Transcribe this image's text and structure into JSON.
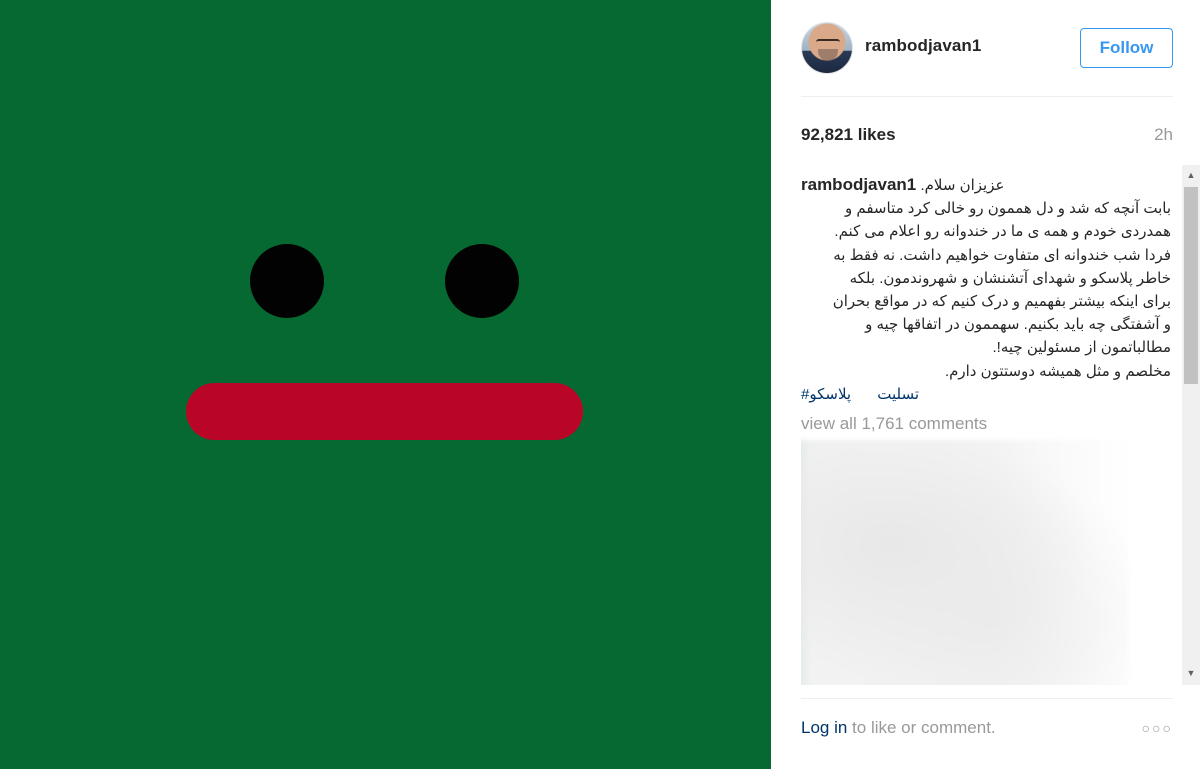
{
  "media": {
    "background_color": "#066931",
    "eye_color": "#020202",
    "mouth_color": "#b90627"
  },
  "post": {
    "username": "rambodjavan1",
    "follow_label": "Follow",
    "likes": "92,821 likes",
    "time": "2h",
    "caption_user": "rambodjavan1",
    "caption_lines": [
      "عزیزان سلام.",
      "بابت آنچه که شد و دل هممون رو خالی کرد متاسفم و",
      "همدردی خودم و همه ی ما در خندوانه رو اعلام می کنم.",
      "فردا شب خندوانه ای متفاوت خواهیم داشت. نه فقط به",
      "خاطر پلاسکو و شهدای آتشنشان و شهروندمون. بلکه",
      "برای اینکه بیشتر بفهمیم و درک کنیم که در مواقع بحران",
      "و آشفتگی چه باید بکنیم. سهممون در اتفاقها چیه و",
      "مطالباتمون از مسئولین چیه!.",
      "مخلصم و مثل همیشه دوستتون دارم."
    ],
    "hashtags": [
      "#تسلیت",
      "پلاسکو"
    ],
    "view_all_comments": "view all 1,761 comments",
    "footer_login": "Log in",
    "footer_rest": " to like or comment.",
    "more_icon": "more-dots-icon",
    "accent_color": "#3897f0",
    "link_color": "#003569"
  }
}
